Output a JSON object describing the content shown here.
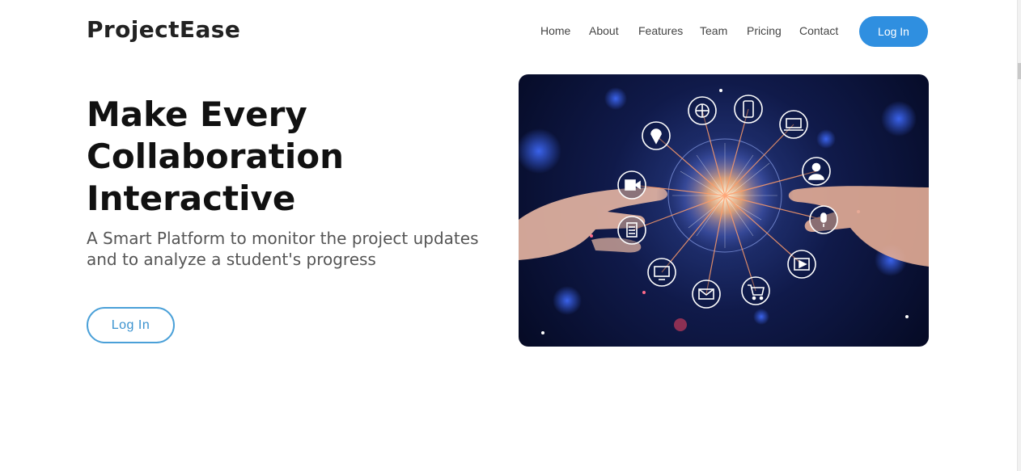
{
  "header": {
    "brand": "ProjectEase",
    "nav": [
      {
        "label": "Home"
      },
      {
        "label": "About"
      },
      {
        "label": "Features"
      },
      {
        "label": "Team"
      },
      {
        "label": "Pricing"
      },
      {
        "label": "Contact"
      }
    ],
    "login_label": "Log In"
  },
  "hero": {
    "title_lines": [
      "Make Every",
      "Collaboration",
      "Interactive"
    ],
    "subtitle_lines": [
      "A Smart Platform to monitor the project updates",
      "and to analyze a student's progress"
    ],
    "login_label": "Log In"
  },
  "image": {
    "icons": [
      "globe-icon",
      "mobile-icon",
      "laptop-icon",
      "location-pin-icon",
      "user-icon",
      "video-camera-icon",
      "microphone-icon",
      "document-icon",
      "play-icon",
      "monitor-icon",
      "mail-icon",
      "shopping-cart-icon"
    ]
  },
  "colors": {
    "accent": "#2f8fe0",
    "outline_button": "#4aa0d8",
    "text_dark": "#111111",
    "text_muted": "#555555"
  }
}
